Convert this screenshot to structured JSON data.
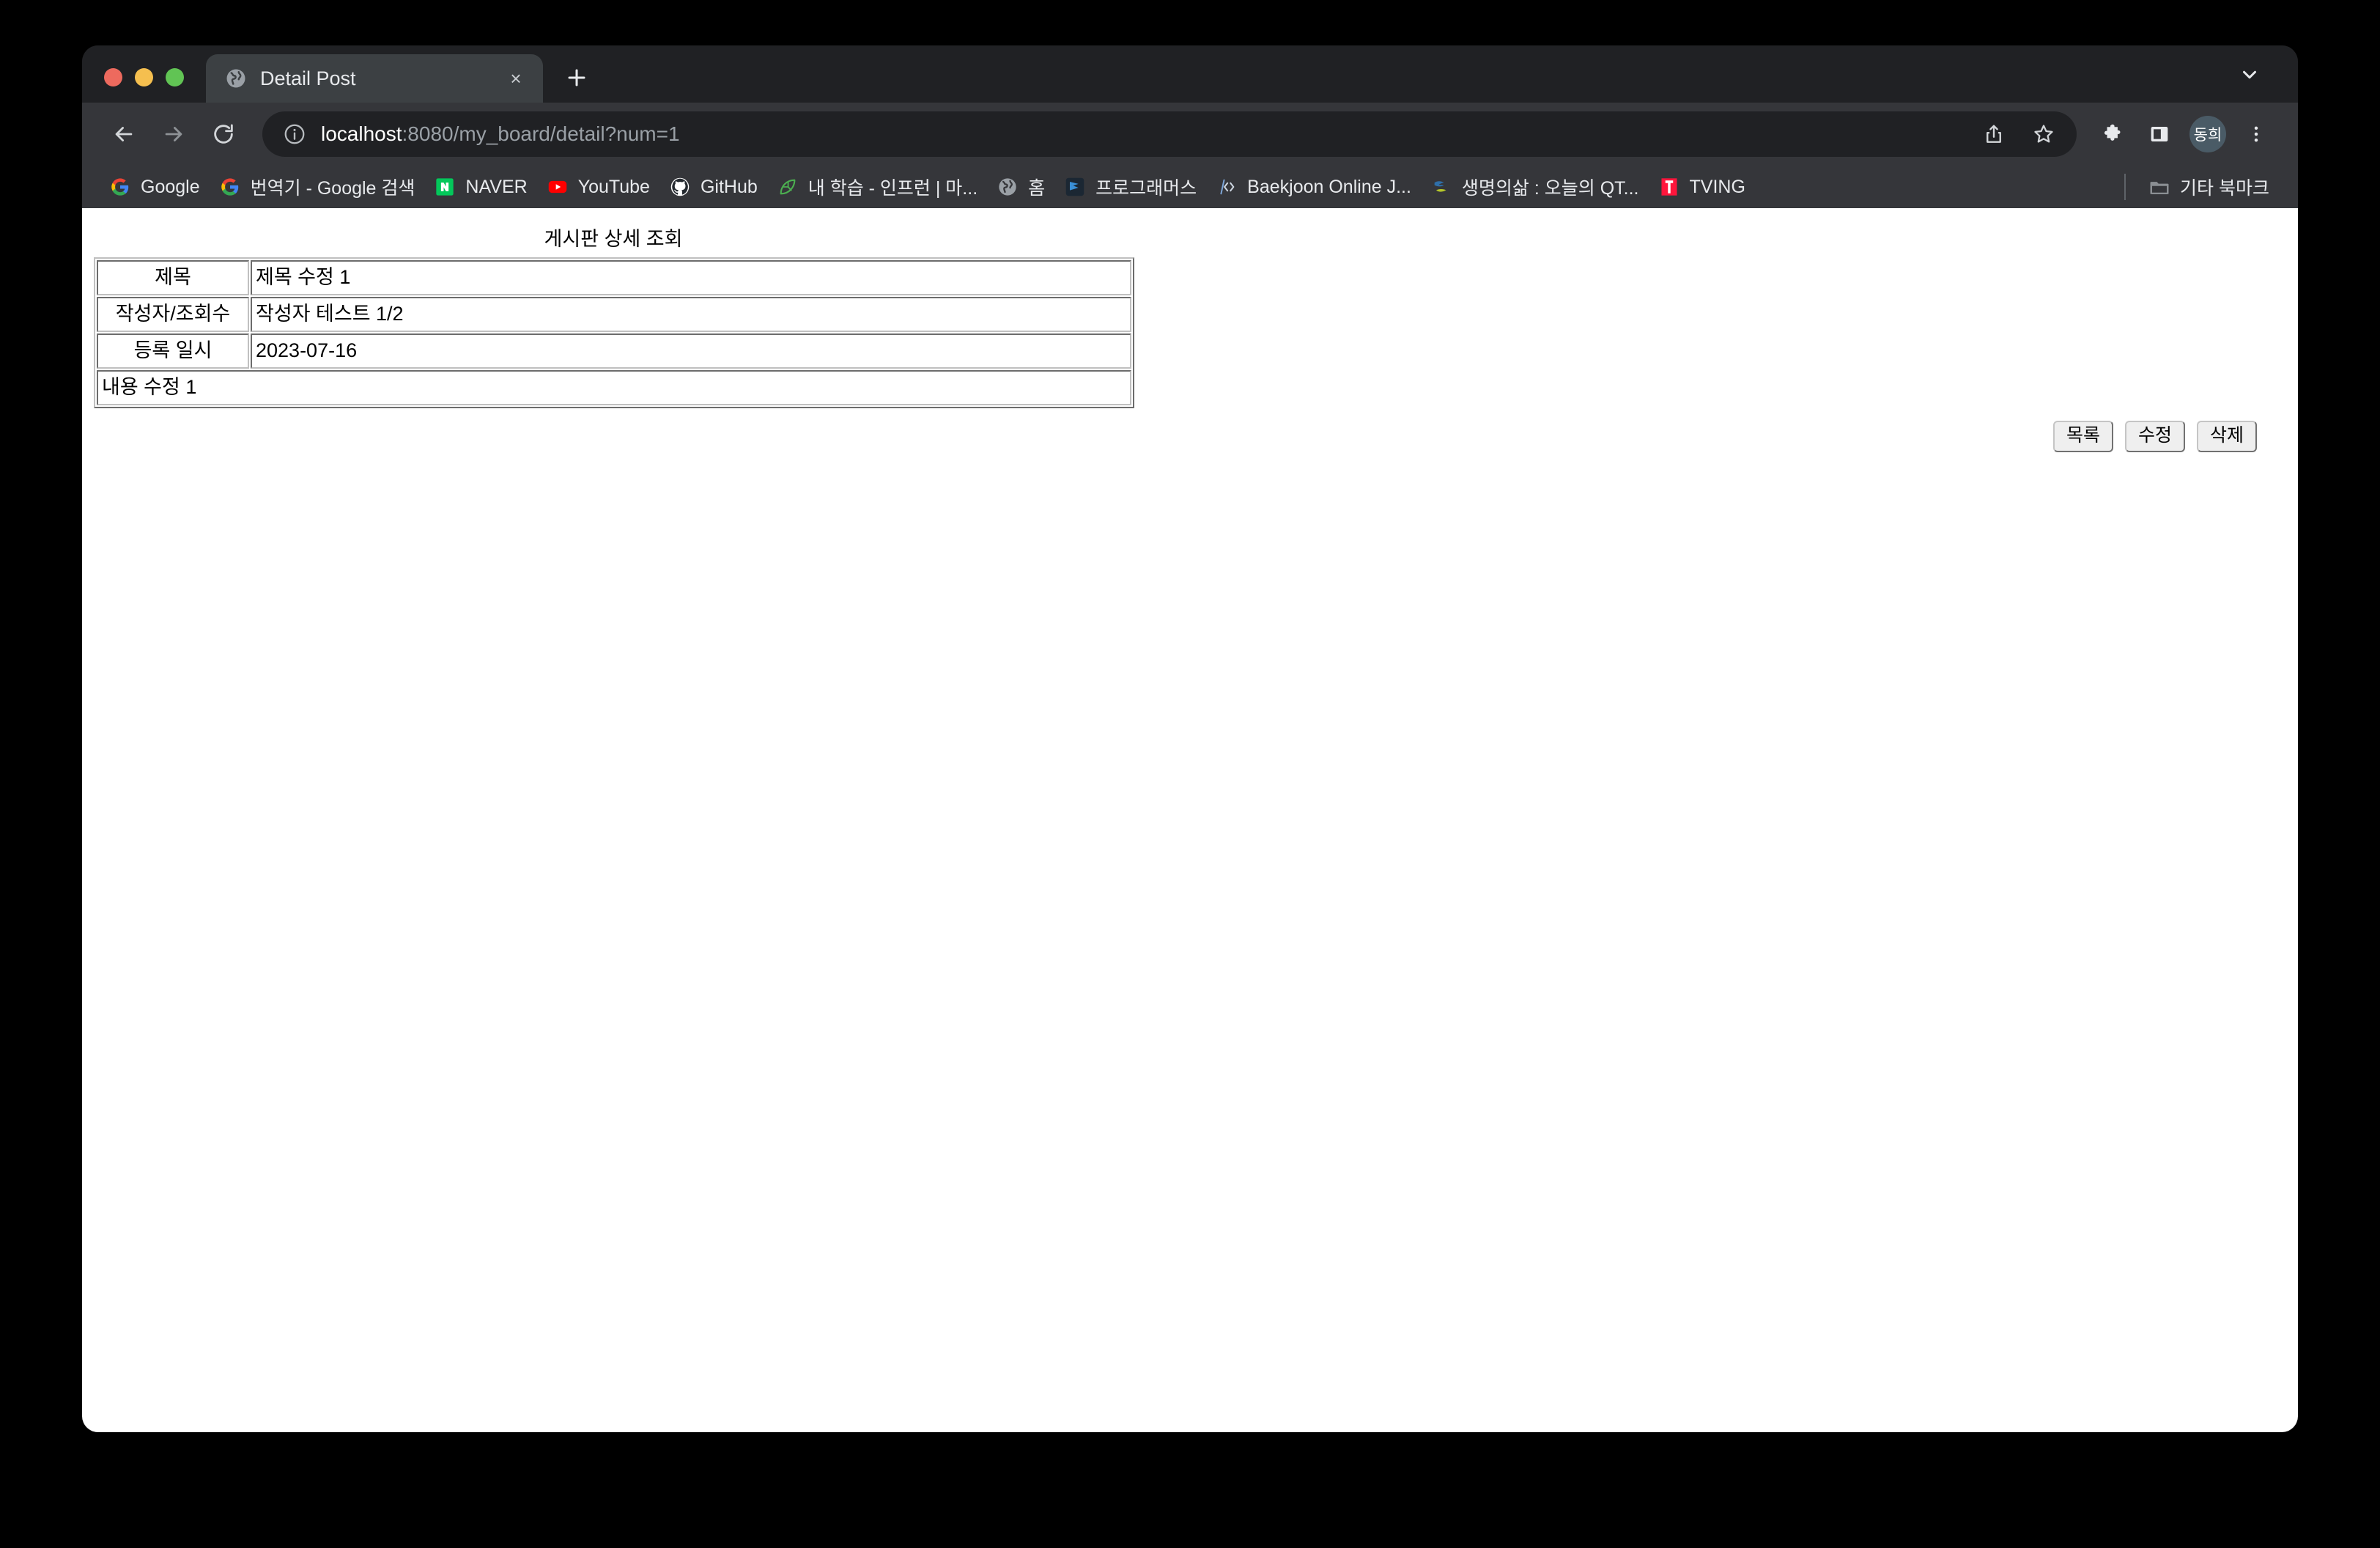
{
  "window": {
    "traffic_lights": [
      "close",
      "minimize",
      "maximize"
    ]
  },
  "tab_strip": {
    "tabs": [
      {
        "title": "Detail Post",
        "favicon": "globe-icon",
        "active": true,
        "close_label": "×"
      }
    ],
    "new_tab_label": "+",
    "tab_search_icon": "chevron-down-icon"
  },
  "toolbar": {
    "back_icon": "arrow-left-icon",
    "forward_icon": "arrow-right-icon",
    "reload_icon": "reload-icon",
    "site_info_icon": "info-circle-icon",
    "url": {
      "host": "localhost",
      "rest": ":8080/my_board/detail?num=1",
      "full": "localhost:8080/my_board/detail?num=1"
    },
    "share_icon": "share-icon",
    "bookmark_star_icon": "star-icon",
    "extensions_icon": "puzzle-icon",
    "side_panel_icon": "side-panel-icon",
    "profile": {
      "initials": "동희",
      "color": "#4a5b66"
    },
    "menu_icon": "three-dot-menu-icon"
  },
  "bookmarks_bar": {
    "items": [
      {
        "label": "Google",
        "icon": "google-icon"
      },
      {
        "label": "번역기 - Google 검색",
        "icon": "google-icon"
      },
      {
        "label": "NAVER",
        "icon": "naver-icon"
      },
      {
        "label": "YouTube",
        "icon": "youtube-icon"
      },
      {
        "label": "GitHub",
        "icon": "github-icon"
      },
      {
        "label": "내 학습 - 인프런 | 마...",
        "icon": "inflearn-icon"
      },
      {
        "label": "홈",
        "icon": "globe-icon"
      },
      {
        "label": "프로그래머스",
        "icon": "programmers-icon"
      },
      {
        "label": "Baekjoon Online J...",
        "icon": "baekjoon-icon"
      },
      {
        "label": "생명의삶 : 오늘의 QT...",
        "icon": "duranno-icon"
      },
      {
        "label": "TVING",
        "icon": "tving-icon"
      }
    ],
    "other_bookmarks": {
      "label": "기타 북마크",
      "icon": "folder-icon"
    }
  },
  "page": {
    "title": "게시판 상세 조회",
    "table": {
      "rows": [
        {
          "label": "제목",
          "value": "제목 수정 1"
        },
        {
          "label": "작성자/조회수",
          "value": "작성자 테스트 1/2"
        },
        {
          "label": "등록 일시",
          "value": "2023-07-16"
        }
      ],
      "content": "내용 수정 1"
    },
    "buttons": [
      {
        "label": "목록",
        "name": "list-button"
      },
      {
        "label": "수정",
        "name": "edit-button"
      },
      {
        "label": "삭제",
        "name": "delete-button"
      }
    ]
  }
}
